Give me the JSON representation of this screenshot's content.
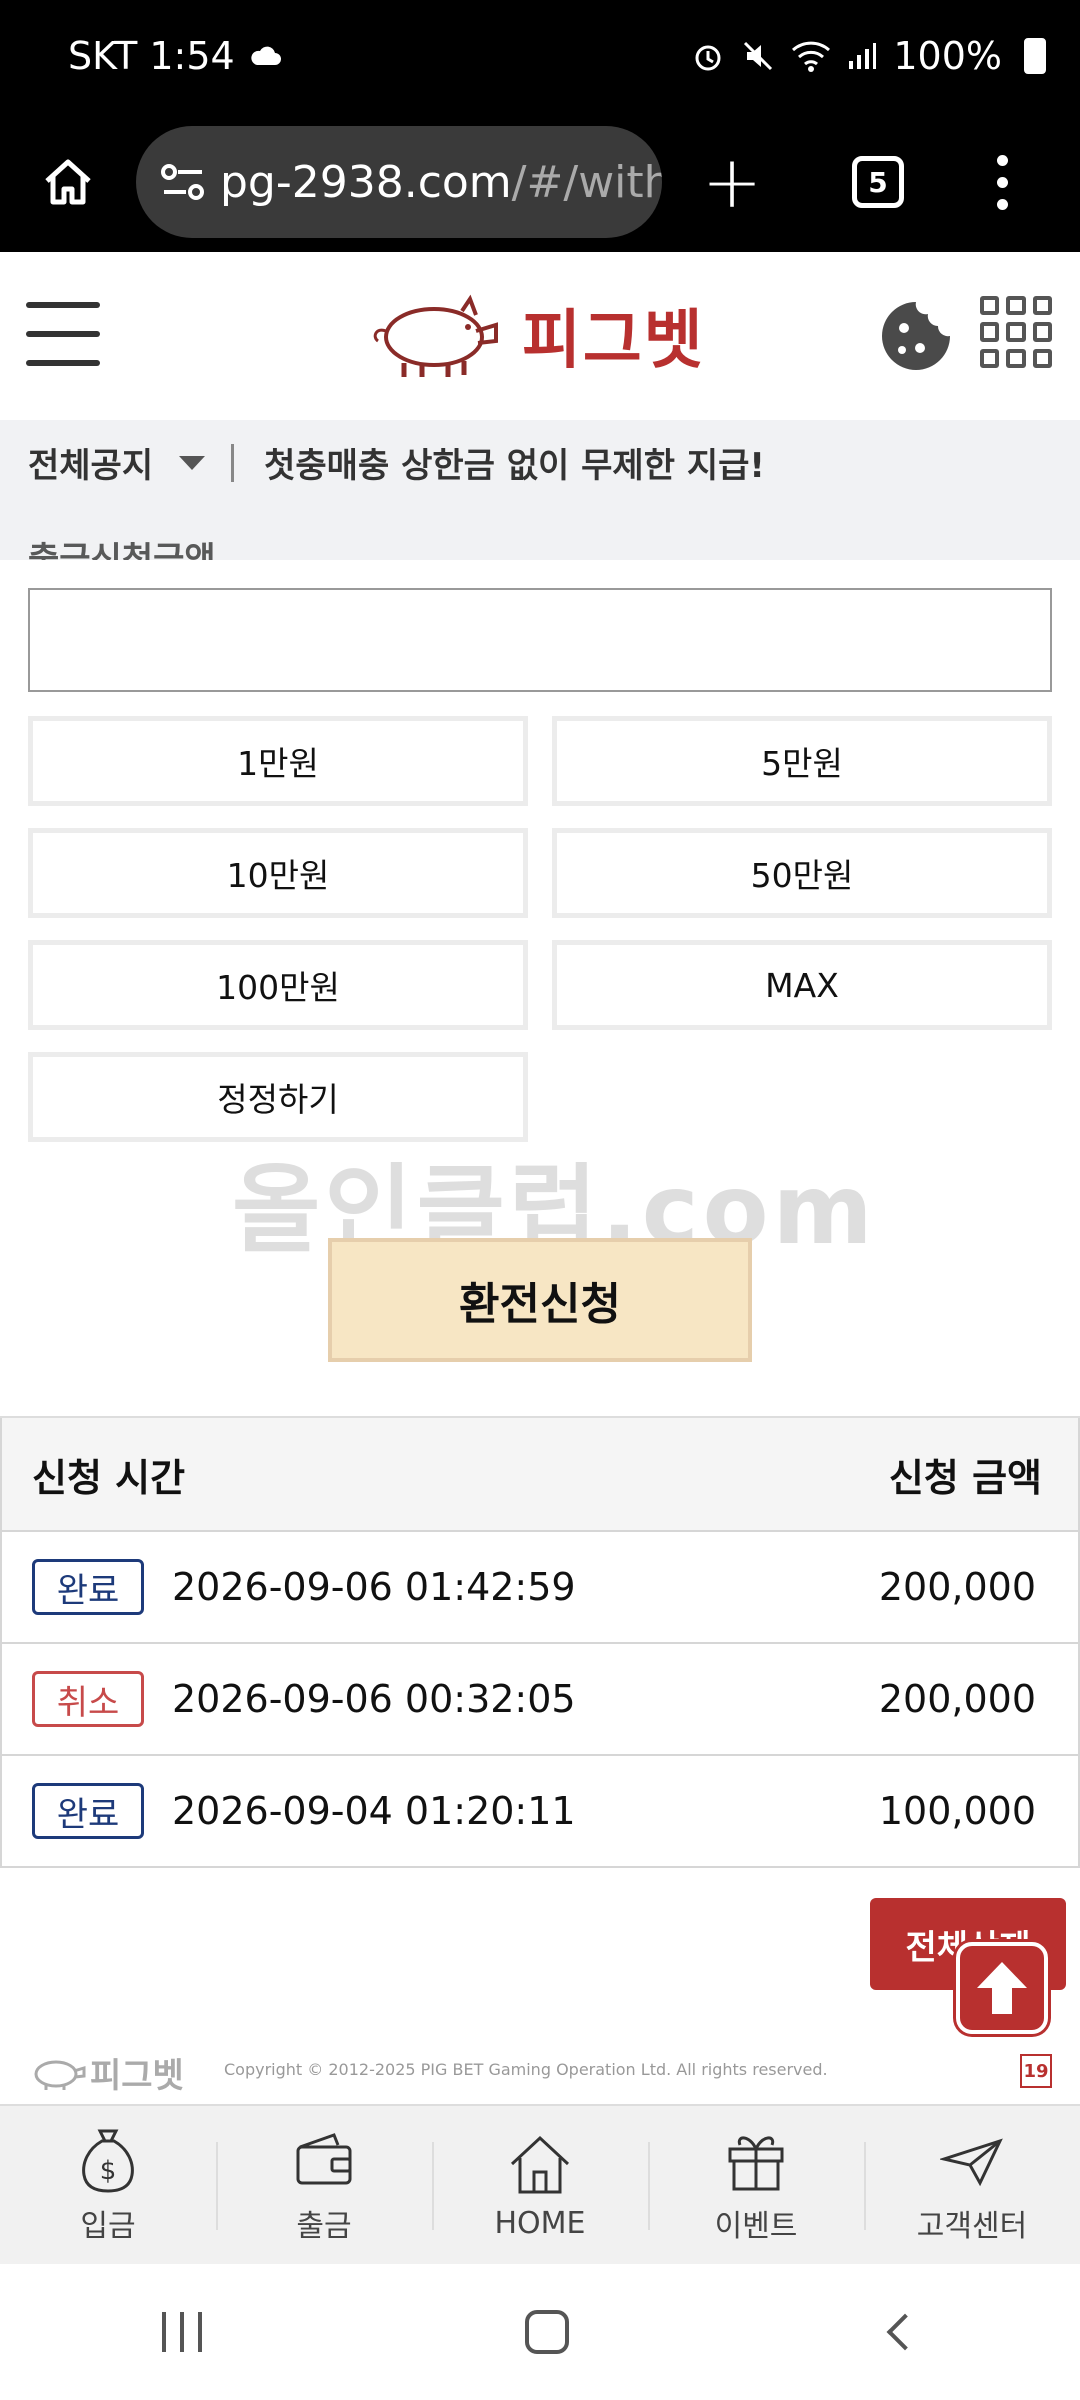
{
  "status_bar": {
    "carrier_time": "SKT 1:54",
    "battery": "100%"
  },
  "browser": {
    "url_main": "pg-2938.com",
    "url_rest": "/#/with",
    "tab_count": "5"
  },
  "header": {
    "logo_text": "피그벳"
  },
  "notice": {
    "category": "전체공지",
    "message": "첫충매충 상한금 없이 무제한 지급!",
    "cut_text": "출금신청금액"
  },
  "form": {
    "amount_value": "",
    "quick_amounts": [
      "1만원",
      "5만원",
      "10만원",
      "50만원",
      "100만원",
      "MAX"
    ],
    "reset_label": "정정하기",
    "submit_label": "환전신청"
  },
  "watermark": "올인클럽.com",
  "history": {
    "col_time": "신청 시간",
    "col_amount": "신청 금액",
    "rows": [
      {
        "status": "완료",
        "time": "2026-09-06 01:42:59",
        "amount": "200,000"
      },
      {
        "status": "취소",
        "time": "2026-09-06 00:32:05",
        "amount": "200,000"
      },
      {
        "status": "완료",
        "time": "2026-09-04 01:20:11",
        "amount": "100,000"
      }
    ]
  },
  "delete_all_label": "전체삭제",
  "footer": {
    "logo_text": "피그벳",
    "copyright": "Copyright © 2012-2025 PIG BET Gaming Operation Ltd. All rights reserved.",
    "age": "19"
  },
  "bottom_nav": [
    {
      "label": "입금",
      "icon": "money-bag-icon"
    },
    {
      "label": "출금",
      "icon": "wallet-icon"
    },
    {
      "label": "HOME",
      "icon": "house-icon"
    },
    {
      "label": "이벤트",
      "icon": "gift-icon"
    },
    {
      "label": "고객센터",
      "icon": "paper-plane-icon"
    }
  ],
  "colors": {
    "brand_red": "#b8302f",
    "submit_bg": "#f7e6c4",
    "done_blue": "#1d3a7a",
    "cancel_red": "#c74a4a"
  }
}
